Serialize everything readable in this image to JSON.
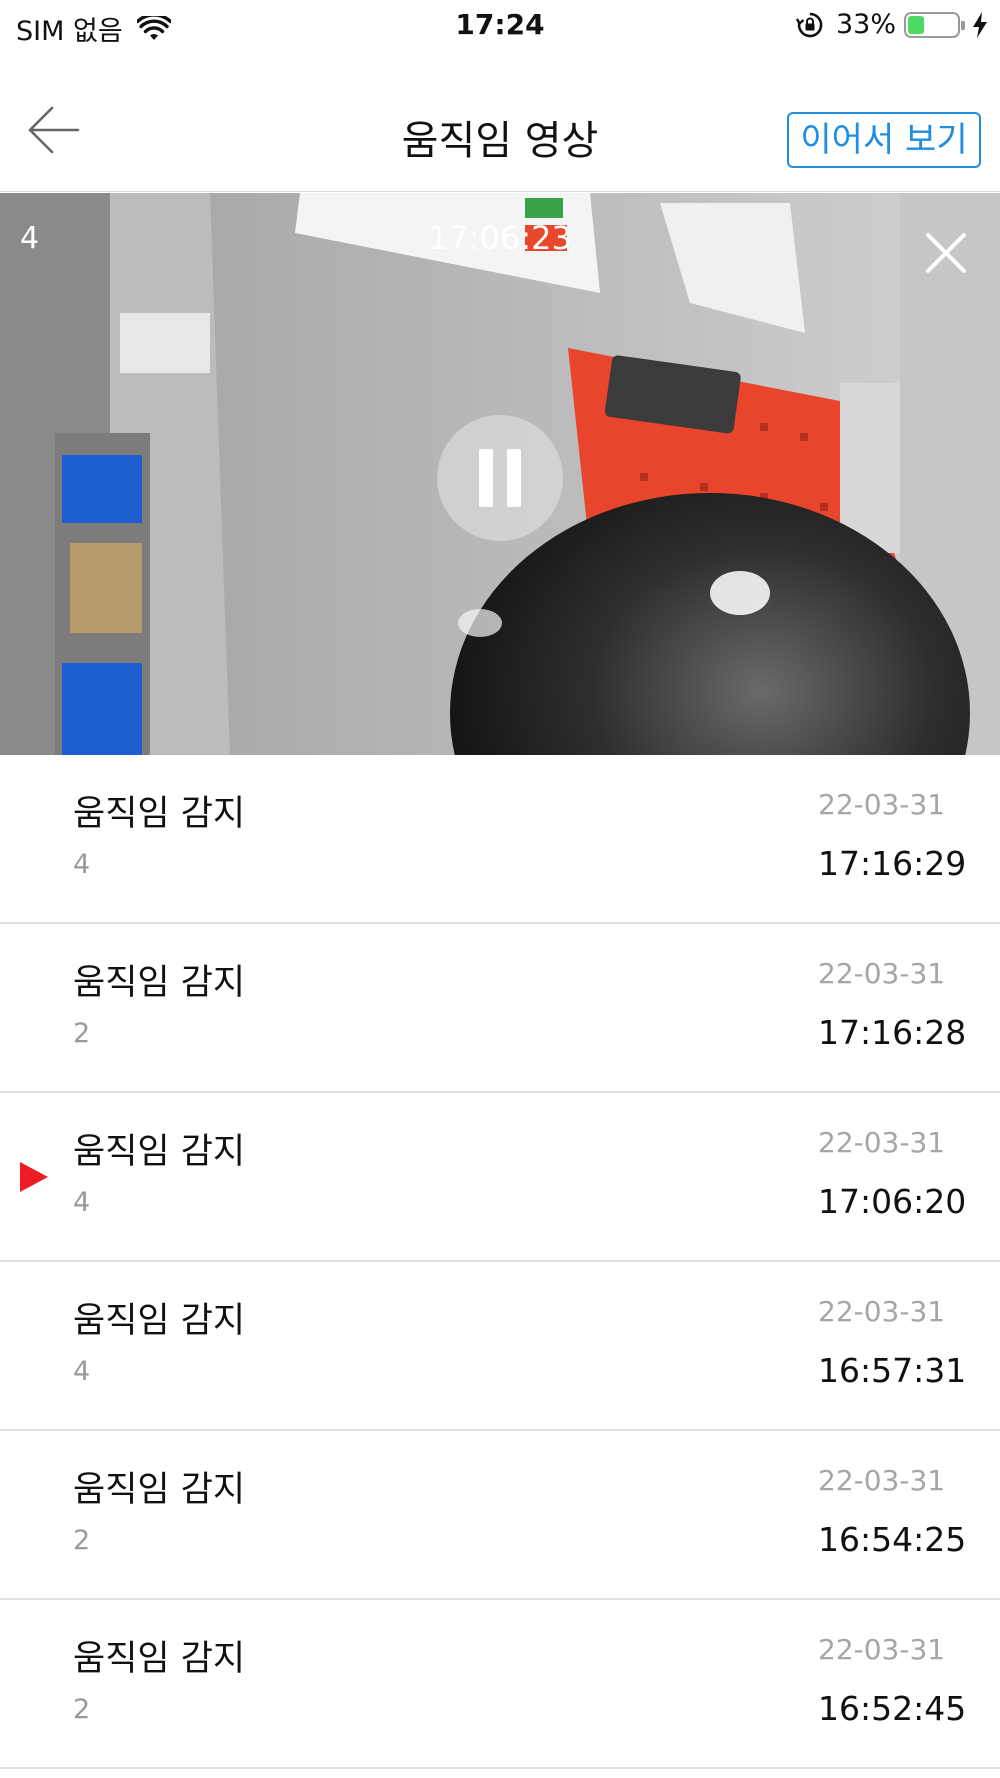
{
  "status_bar": {
    "carrier": "SIM 없음",
    "time": "17:24",
    "battery_percent": "33%",
    "battery_level": 0.33,
    "battery_color": "#4cd964"
  },
  "nav": {
    "title": "움직임 영상",
    "back_icon": "arrow-left-icon",
    "continue_label": "이어서 보기",
    "accent_color": "#1f8de0"
  },
  "video": {
    "channel": "4",
    "timestamp": "17:06:23",
    "state": "playing",
    "close_icon": "close-icon",
    "pause_icon": "pause-icon"
  },
  "events": [
    {
      "title": "움직임 감지",
      "channel": "4",
      "date": "22-03-31",
      "time": "17:16:29",
      "playing": false
    },
    {
      "title": "움직임 감지",
      "channel": "2",
      "date": "22-03-31",
      "time": "17:16:28",
      "playing": false
    },
    {
      "title": "움직임 감지",
      "channel": "4",
      "date": "22-03-31",
      "time": "17:06:20",
      "playing": true
    },
    {
      "title": "움직임 감지",
      "channel": "4",
      "date": "22-03-31",
      "time": "16:57:31",
      "playing": false
    },
    {
      "title": "움직임 감지",
      "channel": "2",
      "date": "22-03-31",
      "time": "16:54:25",
      "playing": false
    },
    {
      "title": "움직임 감지",
      "channel": "2",
      "date": "22-03-31",
      "time": "16:52:45",
      "playing": false
    }
  ],
  "play_marker_color": "#ee1c24"
}
